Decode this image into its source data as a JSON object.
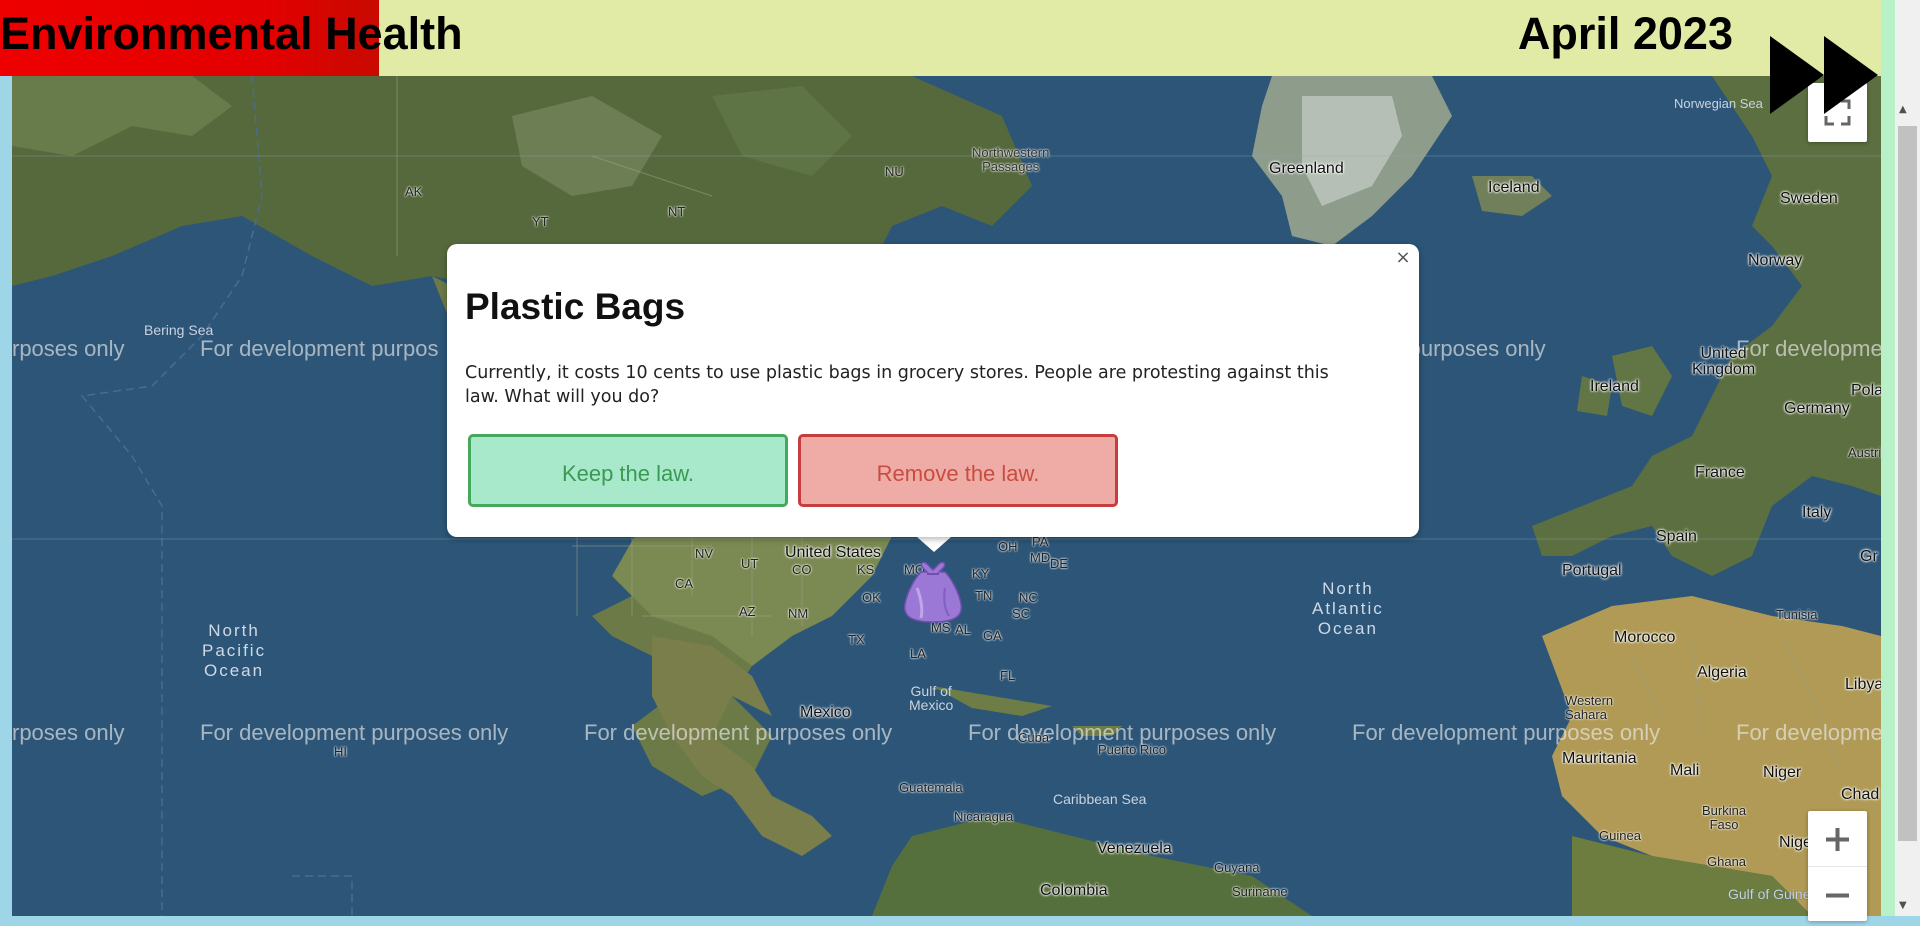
{
  "header": {
    "title": "Environmental Health",
    "date": "April 2023",
    "health_level": 0.24,
    "fast_forward_icon": "fast-forward-icon"
  },
  "popup": {
    "title": "Plastic Bags",
    "text": "Currently, it costs 10 cents to use plastic bags in grocery stores. People are protesting against this law. What will you do?",
    "close_label": "×",
    "keep_label": "Keep the law.",
    "remove_label": "Remove the law.",
    "keep_color": "#a8e9cc",
    "remove_color": "#efaca7"
  },
  "map": {
    "watermark": "For development purposes only",
    "watermark_clipped": "rposes only",
    "watermark_clipped_right": "For developme",
    "watermark_partial": "For development purpos",
    "watermark_partial2": "evelopment purposes only",
    "watermark_partial3": "elopment purposes only",
    "watermark_partial4": "velopment purposes only",
    "labels": {
      "greenland": "Greenland",
      "iceland": "Iceland",
      "sweden": "Sweden",
      "norway": "Norway",
      "norwegian_sea": "Norwegian Sea",
      "nw_passages": "Northwestern\nPassages",
      "nu": "NU",
      "nt": "NT",
      "yt": "YT",
      "ak": "AK",
      "bering_sea": "Bering Sea",
      "united_kingdom": "United\nKingdom",
      "ireland": "Ireland",
      "germany": "Germany",
      "poland": "Polanc",
      "austria": "Austria",
      "france": "France",
      "italy": "Italy",
      "spain": "Spain",
      "portugal": "Portugal",
      "gr": "Gr",
      "tunisia": "Tunisia",
      "morocco": "Morocco",
      "algeria": "Algeria",
      "libya": "Libya",
      "western_sahara": "Western\nSahara",
      "mauritania": "Mauritania",
      "mali": "Mali",
      "niger": "Niger",
      "chad": "Chad",
      "burkina_faso": "Burkina\nFaso",
      "guinea": "Guinea",
      "ghana": "Ghana",
      "nigeria": "Nigeria",
      "gulf_of_guinea": "Gulf of Guinea",
      "north_atlantic": "North\nAtlantic\nOcean",
      "north_pacific": "North\nPacific\nOcean",
      "united_states": "United States",
      "mexico": "Mexico",
      "gulf_of_mexico": "Gulf of\nMexico",
      "cuba": "Cuba",
      "puerto_rico": "Puerto Rico",
      "guatemala": "Guatemala",
      "nicaragua": "Nicaragua",
      "caribbean_sea": "Caribbean Sea",
      "venezuela": "Venezuela",
      "colombia": "Colombia",
      "guyana": "Guyana",
      "suriname": "Suriname",
      "hi": "HI",
      "nv": "NV",
      "ut": "UT",
      "co": "CO",
      "ks": "KS",
      "mo": "MO",
      "ky": "KY",
      "md": "MD",
      "de": "DE",
      "oh": "OH",
      "pa": "PA",
      "ca": "CA",
      "az": "AZ",
      "nm": "NM",
      "ok": "OK",
      "tx": "TX",
      "la": "LA",
      "al": "AL",
      "ga": "GA",
      "sc": "SC",
      "nc": "NC",
      "tn": "TN",
      "fl": "FL",
      "ms": "MS"
    },
    "marker_icon": "plastic-bag-icon",
    "fullscreen_icon": "fullscreen-icon",
    "zoom_in_icon": "plus-icon",
    "zoom_out_icon": "minus-icon"
  }
}
